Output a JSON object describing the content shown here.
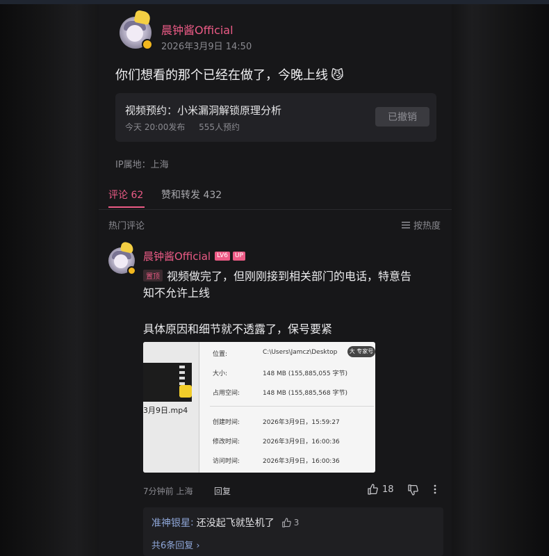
{
  "post": {
    "author": "晨钟酱Official",
    "date": "2026年3月9日 14:50",
    "content": "你们想看的那个已经在做了，今晚上线",
    "emoji": "😼",
    "reservation": {
      "title": "视频预约：小米漏洞解锁原理分析",
      "time": "今天 20:00发布",
      "count": "555人预约",
      "button": "已撤销"
    },
    "ip_location": "IP属地：上海"
  },
  "tabs": [
    {
      "label": "评论 62",
      "active": true
    },
    {
      "label": "赞和转发 432",
      "active": false
    }
  ],
  "comments_header": {
    "title": "热门评论",
    "sort_label": "按热度"
  },
  "comment": {
    "author": "晨钟酱Official",
    "level_tag": "LV6",
    "up_tag": "UP",
    "pin_tag": "置顶",
    "text_line1": "视频做完了，但刚刚接到相关部门的电话，特意告",
    "text_line2": "知不允许上线",
    "text_line3": "具体原因和细节就不透露了，保号要紧",
    "file_info": {
      "filename": "3月9日.mp4",
      "location_label": "位置:",
      "location_value": "C:\\Users\\Jamcz\\Desktop",
      "size_label": "大小:",
      "size_value": "148 MB (155,885,055 字节)",
      "disk_label": "占用空间:",
      "disk_value": "148 MB (155,885,568 字节)",
      "created_label": "创建时间:",
      "created_value": "2026年3月9日，15:59:27",
      "modified_label": "修改时间:",
      "modified_value": "2026年3月9日，16:00:36",
      "accessed_label": "访问时间:",
      "accessed_value": "2026年3月9日，16:00:36",
      "watermark": "大 专家号"
    },
    "time_loc": "7分钟前 上海",
    "reply_label": "回复",
    "likes": "18",
    "reply": {
      "author": "准神银星",
      "text": "还没起飞就坠机了",
      "likes": "3"
    },
    "more_replies": "共6条回复 ›"
  },
  "colors": {
    "accent": "#ec5b86",
    "background": "#171719",
    "card": "#222226"
  }
}
